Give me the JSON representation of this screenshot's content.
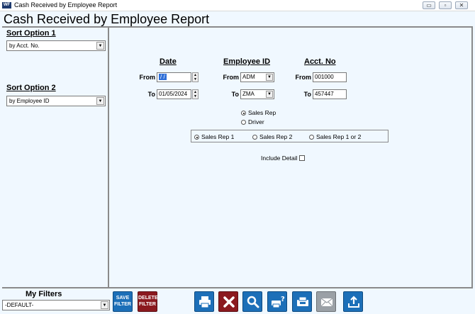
{
  "window": {
    "title": "Cash Received by Employee Report",
    "icon_text": "WF",
    "controls": {
      "minimize": "▭",
      "restore": "▫",
      "close": "✕"
    }
  },
  "report": {
    "title": "Cash Received by Employee Report"
  },
  "sort": {
    "option1_label": "Sort Option 1",
    "option1_value": "by Acct. No.",
    "option2_label": "Sort Option 2",
    "option2_value": "by Employee ID"
  },
  "filters": {
    "date": {
      "heading": "Date",
      "from_label": "From",
      "from_value": "/ /",
      "to_label": "To",
      "to_value": "01/05/2024"
    },
    "employee": {
      "heading": "Employee ID",
      "from_label": "From",
      "from_value": "ADM",
      "to_label": "To",
      "to_value": "ZMA"
    },
    "acct": {
      "heading": "Acct. No",
      "from_label": "From",
      "from_value": "001000",
      "to_label": "To",
      "to_value": "457447"
    }
  },
  "employee_type": {
    "options": [
      "Sales Rep",
      "Driver"
    ],
    "selected": "Sales Rep"
  },
  "sales_rep_group": {
    "options": [
      "Sales Rep 1",
      "Sales Rep 2",
      "Sales Rep 1 or 2"
    ],
    "selected": "Sales Rep 1"
  },
  "include_detail": {
    "label": "Include Detail",
    "checked": false
  },
  "my_filters": {
    "label": "My Filters",
    "value": "-DEFAULT-"
  },
  "toolbar": {
    "save_filter": "SAVE FILTER",
    "delete_filter": "DELETE FILTER",
    "icons": [
      "print-icon",
      "cancel-icon",
      "preview-icon",
      "print-help-icon",
      "fax-icon",
      "email-icon",
      "export-icon"
    ]
  },
  "colors": {
    "background": "#f0f8ff",
    "button_blue": "#1c6fb8",
    "button_red": "#8b1a1f",
    "button_gray": "#9aa0a6",
    "selection": "#3070d8"
  }
}
